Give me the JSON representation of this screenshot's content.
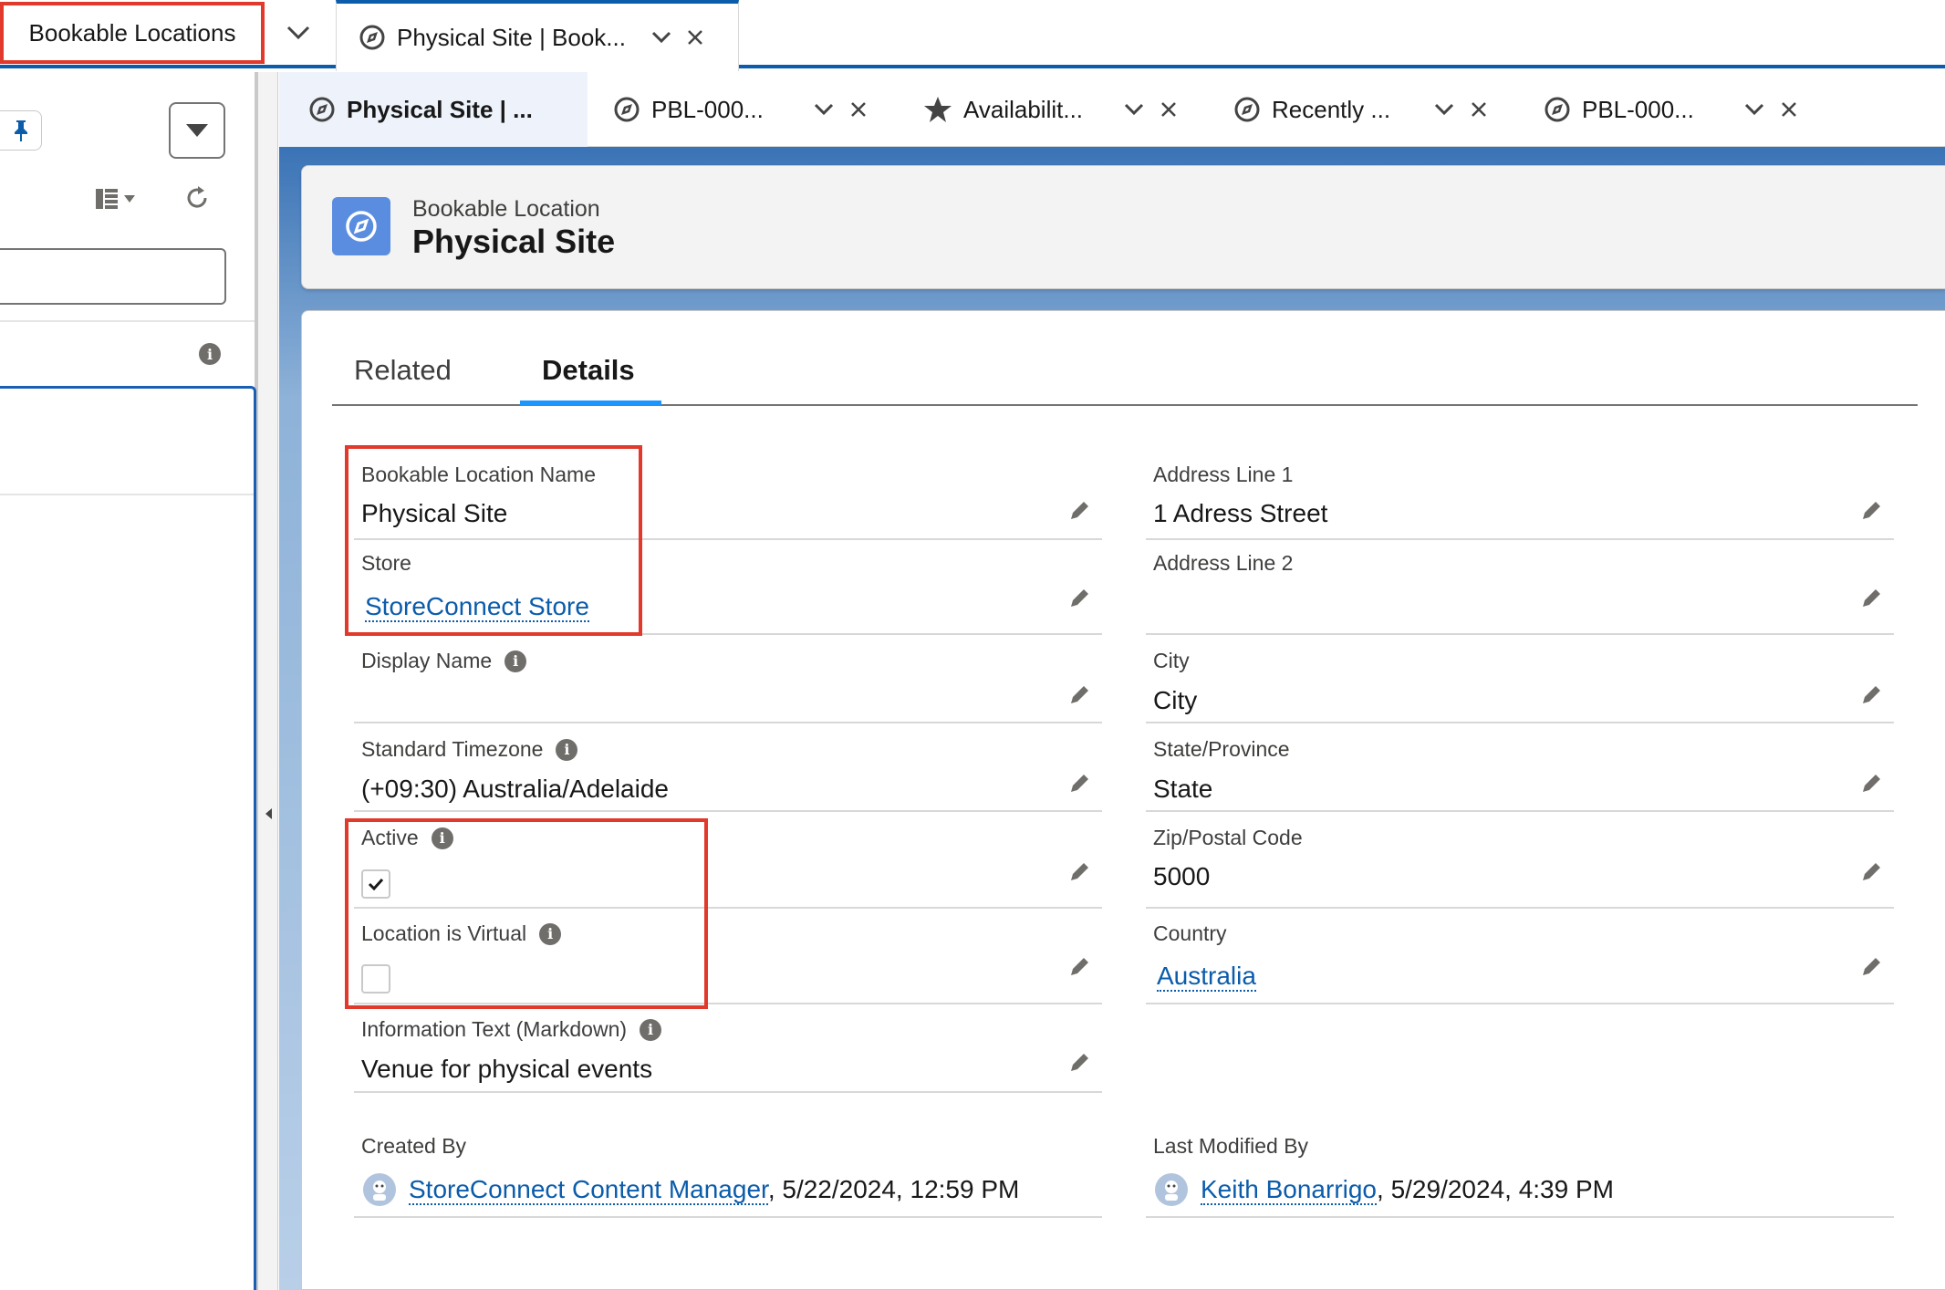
{
  "top_nav": {
    "app_tab_label": "Bookable Locations",
    "primary_tab_label": "Physical Site | Book..."
  },
  "sub_tabs": [
    {
      "label": "Physical Site | ...",
      "icon": "compass-icon"
    },
    {
      "label": "PBL-000...",
      "icon": "compass-icon"
    },
    {
      "label": "Availabilit...",
      "icon": "star-icon"
    },
    {
      "label": "Recently ...",
      "icon": "compass-icon"
    },
    {
      "label": "PBL-000...",
      "icon": "compass-icon"
    }
  ],
  "record": {
    "object_type": "Bookable Location",
    "title": "Physical Site"
  },
  "tabs": {
    "related": "Related",
    "details": "Details"
  },
  "fields": {
    "name_label": "Bookable Location Name",
    "name_value": "Physical Site",
    "store_label": "Store",
    "store_value": "StoreConnect Store",
    "display_name_label": "Display Name",
    "timezone_label": "Standard Timezone",
    "timezone_value": "(+09:30) Australia/Adelaide",
    "active_label": "Active",
    "active_checked": true,
    "virtual_label": "Location is Virtual",
    "virtual_checked": false,
    "info_text_label": "Information Text (Markdown)",
    "info_text_value": "Venue for physical events",
    "address1_label": "Address Line 1",
    "address1_value": "1 Adress Street",
    "address2_label": "Address Line 2",
    "city_label": "City",
    "city_value": "City",
    "state_label": "State/Province",
    "state_value": "State",
    "zip_label": "Zip/Postal Code",
    "zip_value": "5000",
    "country_label": "Country",
    "country_value": "Australia",
    "created_by_label": "Created By",
    "created_by_user": "StoreConnect Content Manager",
    "created_by_date": ", 5/22/2024, 12:59 PM",
    "modified_by_label": "Last Modified By",
    "modified_by_user": "Keith Bonarrigo",
    "modified_by_date": ", 5/29/2024, 4:39 PM"
  },
  "colors": {
    "brand_blue": "#0b5cab",
    "highlight_red": "#e1392b",
    "record_icon": "#5a8de0",
    "tab_underline": "#1b96ff"
  }
}
